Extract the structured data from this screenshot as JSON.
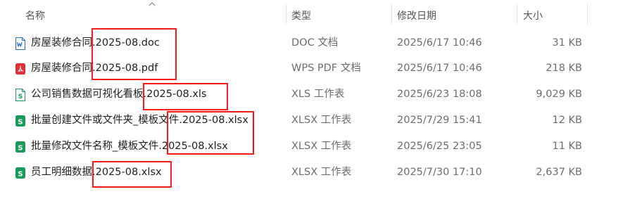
{
  "columns": {
    "name": "名称",
    "type": "类型",
    "modified": "修改日期",
    "size": "大小"
  },
  "files": [
    {
      "name": "房屋装修合同.2025-08.doc",
      "type": "DOC 文档",
      "modified": "2025/6/17 10:46",
      "size": "31 KB",
      "icon": "word-doc-icon"
    },
    {
      "name": "房屋装修合同.2025-08.pdf",
      "type": "WPS PDF 文档",
      "modified": "2025/6/17 10:46",
      "size": "218 KB",
      "icon": "pdf-icon"
    },
    {
      "name": "公司销售数据可视化看板.2025-08.xls",
      "type": "XLS 工作表",
      "modified": "2025/6/23 18:08",
      "size": "9,029 KB",
      "icon": "spreadsheet-icon"
    },
    {
      "name": "批量创建文件或文件夹_模板文件.2025-08.xlsx",
      "type": "XLSX 工作表",
      "modified": "2025/7/29 15:41",
      "size": "12 KB",
      "icon": "spreadsheet-icon"
    },
    {
      "name": "批量修改文件名称_模板文件.2025-08.xlsx",
      "type": "XLSX 工作表",
      "modified": "2025/6/25 23:05",
      "size": "11 KB",
      "icon": "spreadsheet-icon"
    },
    {
      "name": "员工明细数据.2025-08.xlsx",
      "type": "XLSX 工作表",
      "modified": "2025/7/30 17:10",
      "size": "2,637 KB",
      "icon": "spreadsheet-icon"
    }
  ],
  "colors": {
    "highlight": "#ff1a1a",
    "word_blue": "#2b6cd4",
    "pdf_red": "#e0303a",
    "sheet_green": "#1a9b5a"
  }
}
